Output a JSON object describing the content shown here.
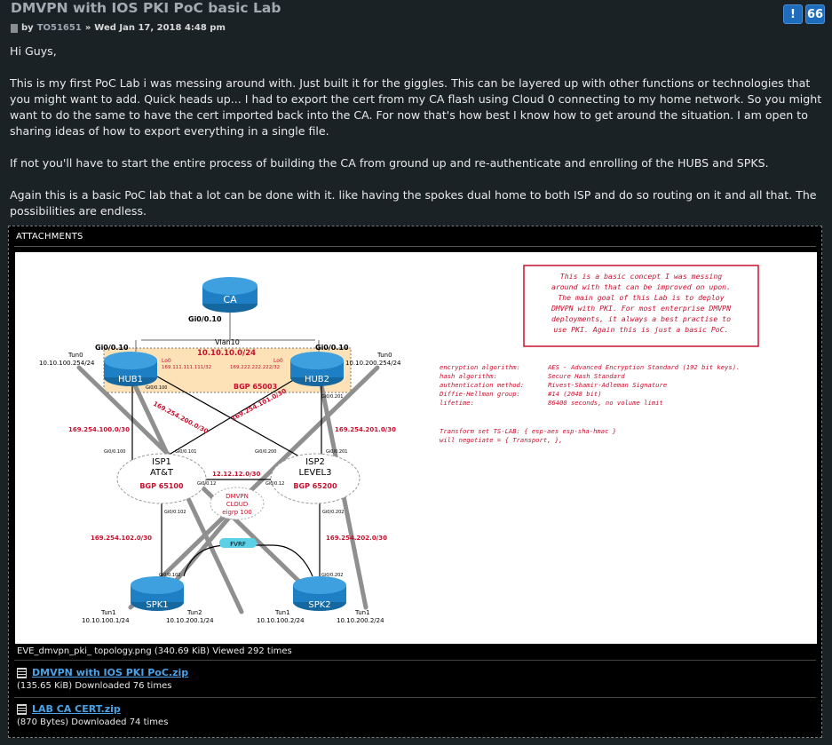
{
  "post": {
    "title": "DMVPN with IOS PKI PoC basic Lab",
    "by_label": "by",
    "author": "TO51651",
    "separator": "»",
    "date": "Wed Jan 17, 2018 4:48 pm",
    "buttons": {
      "report": "!",
      "quote": "66"
    },
    "paragraphs": [
      "Hi Guys,",
      "This is my first PoC Lab i was messing around with. Just built it for the giggles. This can be layered up with other functions or technologies that you might want to add. Quick heads up... I had to export the cert from my CA flash using Cloud 0 connecting to my home network. So you might want to do the same to have the cert imported back into the CA. For now that's how best I know how to get around the situation. I am open to sharing ideas of how to export everything in a single file.",
      "If not you'll have to start the entire process of building the CA from ground up and re-authenticate and enrolling of the HUBS and SPKS.",
      "Again this is a basic PoC lab that a lot can be done with it. like having the spokes dual home to both ISP and do so routing on it and all that. The possibilities are endless."
    ]
  },
  "attachments": {
    "header": "ATTACHMENTS",
    "image_caption": "EVE_dmvpn_pki_ topology.png (340.69 KiB) Viewed 292 times",
    "files": [
      {
        "name": "DMVPN with IOS PKI PoC.zip",
        "meta": "(135.65 KiB) Downloaded 76 times"
      },
      {
        "name": "LAB CA CERT.zip",
        "meta": "(870 Bytes) Downloaded 74 times"
      }
    ]
  },
  "diagram": {
    "note": [
      "This is a basic concept I was messing",
      "around with that can be improved on upon.",
      "The main goal of this Lab is to deploy",
      "DMVPN with PKI. For most enterprise DMVPN",
      "deployments, it always a best practise to",
      "use PKI. Again this is just a basic PoC."
    ],
    "crypto_keys": [
      "encryption algorithm:",
      "hash algorithm:",
      "authentication method:",
      "Diffie-Hellman group:",
      "lifetime:"
    ],
    "crypto_vals": [
      "AES - Advanced Encryption Standard (192 bit keys).",
      "Secure Hash Standard",
      "Rivest-Shamir-Adleman Signature",
      "#14 (2048 bit)",
      "86400 seconds, no volume limit"
    ],
    "transform": [
      "Transform set TS-LAB: { esp-aes esp-sha-hmac  }",
      "will negotiate = { Transport,  },"
    ],
    "ca": "CA",
    "ca_if": "Gi0/0.10",
    "hub1": "HUB1",
    "hub2": "HUB2",
    "hub1_gi": "Gi0/0.10",
    "hub2_gi": "Gi0/0.10",
    "vlan": "Vlan10",
    "vlan_net": "10.10.10.0/24",
    "bgp_hub": "BGP 65003",
    "hub1_tun": "Tun0",
    "hub1_tun_ip": "10.10.100.254/24",
    "hub2_tun": "Tun0",
    "hub2_tun_ip": "10.10.200.254/24",
    "hub1_lo": "Lo0",
    "hub1_lo_ip": "169.111.111.111/32",
    "hub2_lo": "Lo0",
    "hub2_lo_ip": "169.222.222.222/32",
    "hub1_port": "Gi0/0.100",
    "hub2_port": "Gi0/0.201",
    "net_100": "169.254.100.0/30",
    "net_200": "169.254.200.0/30",
    "net_101": "169.254.101.0/30",
    "net_201": "169.254.201.0/30",
    "isp1": [
      "ISP1",
      "AT&T"
    ],
    "isp1_bgp": "BGP 65100",
    "isp2": [
      "ISP2",
      "LEVEL3"
    ],
    "isp2_bgp": "BGP 65200",
    "isp_link": "12.12.12.0/30",
    "isp1_ports": [
      "Gi0/0.100",
      "Gi0/0.101",
      "Gi0/0.12",
      "Gi0/0.102"
    ],
    "isp2_ports": [
      "Gi0/0.200",
      "Gi0/0.201",
      "Gi0/0.12",
      "Gi0/0.202"
    ],
    "cloud": [
      "DMVPN",
      "CLOUD",
      "eigrp 100"
    ],
    "fvrf": "FVRF",
    "net_102": "169.254.102.0/30",
    "net_202": "169.254.202.0/30",
    "spk1": "SPK1",
    "spk2": "SPK2",
    "spk1_port": "Gi0/0.102",
    "spk2_port": "Gi0/0.202",
    "spk_tuns": [
      {
        "name": "Tun1",
        "ip": "10.10.100.1/24"
      },
      {
        "name": "Tun2",
        "ip": "10.10.200.1/24"
      },
      {
        "name": "Tun1",
        "ip": "10.10.100.2/24"
      },
      {
        "name": "Tun1",
        "ip": "10.10.200.2/24"
      }
    ]
  },
  "colors": {
    "accent_blue": "#1e6dbd",
    "link": "#4aa3e8",
    "router": "#1e7fc4",
    "red": "#c8102e"
  }
}
